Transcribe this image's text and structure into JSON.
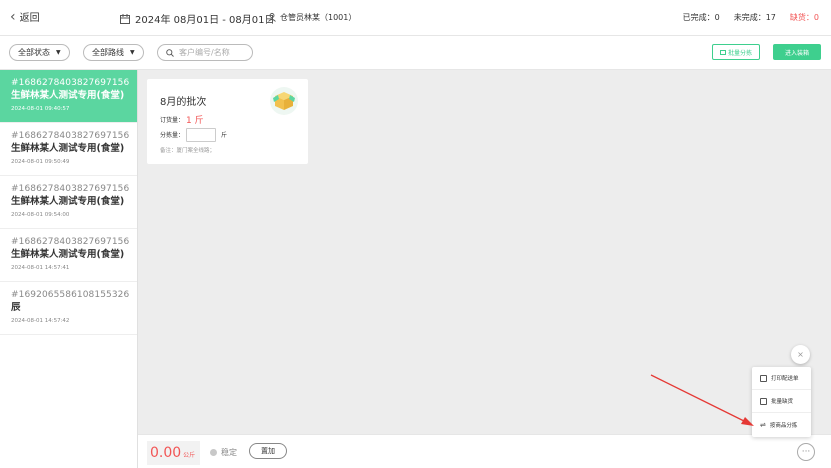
{
  "header": {
    "back_label": "返回",
    "date_range": "2024年 08月01日 - 08月01日",
    "operator": "仓管员林某（1001）",
    "completed": "已完成：0",
    "uncompleted": "未完成：17",
    "shortage": "缺货：0"
  },
  "filters": {
    "status": "全部状态",
    "route": "全部路线",
    "search_placeholder": "客户编号/名称",
    "batch_sort": "批量分拣",
    "enter_basket": "进入装箱"
  },
  "customers": [
    {
      "number": "#1686278403827697156",
      "name": "生鲜林某人测试专用(食堂)",
      "time": "2024-08-01 09:40:57"
    },
    {
      "number": "#1686278403827697156",
      "name": "生鲜林某人测试专用(食堂)",
      "time": "2024-08-01 09:50:49"
    },
    {
      "number": "#1686278403827697156",
      "name": "生鲜林某人测试专用(食堂)",
      "time": "2024-08-01 09:54:00"
    },
    {
      "number": "#1686278403827697156",
      "name": "生鲜林某人测试专用(食堂)",
      "time": "2024-08-01 14:57:41"
    },
    {
      "number": "#1692065586108155326",
      "name": "辰",
      "time": "2024-08-01 14:57:42"
    }
  ],
  "card": {
    "title": "8月的批次",
    "order_label": "订货量：",
    "order_value": "1 斤",
    "sort_label": "分拣量：",
    "sort_unit": "斤",
    "remark": "备注：厦门案全线路；"
  },
  "bottom": {
    "weight_value": "0.00",
    "weight_unit": "公斤",
    "stable_label": "稳定",
    "tare_label": "置加"
  },
  "menu": {
    "items": [
      "打印配送单",
      "批量缺货",
      "按商品分拣"
    ]
  },
  "colors": {
    "accent": "#3ecf8e",
    "active_row": "#5bd6a0",
    "warning": "#f25555",
    "arrow": "#e53935"
  }
}
